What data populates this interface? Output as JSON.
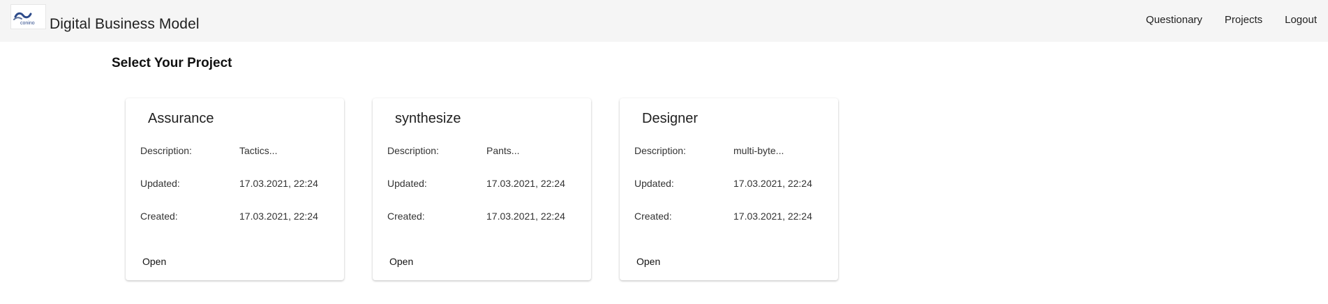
{
  "header": {
    "logo_text": "conino",
    "app_title": "Digital Business Model",
    "nav": [
      {
        "label": "Questionary"
      },
      {
        "label": "Projects"
      },
      {
        "label": "Logout"
      }
    ]
  },
  "main": {
    "title": "Select Your Project",
    "field_labels": {
      "description": "Description:",
      "updated": "Updated:",
      "created": "Created:"
    },
    "open_label": "Open",
    "projects": [
      {
        "name": "Assurance",
        "description": "Tactics...",
        "updated": "17.03.2021, 22:24",
        "created": "17.03.2021, 22:24"
      },
      {
        "name": "synthesize",
        "description": "Pants...",
        "updated": "17.03.2021, 22:24",
        "created": "17.03.2021, 22:24"
      },
      {
        "name": "Designer",
        "description": "multi-byte...",
        "updated": "17.03.2021, 22:24",
        "created": "17.03.2021, 22:24"
      }
    ]
  }
}
